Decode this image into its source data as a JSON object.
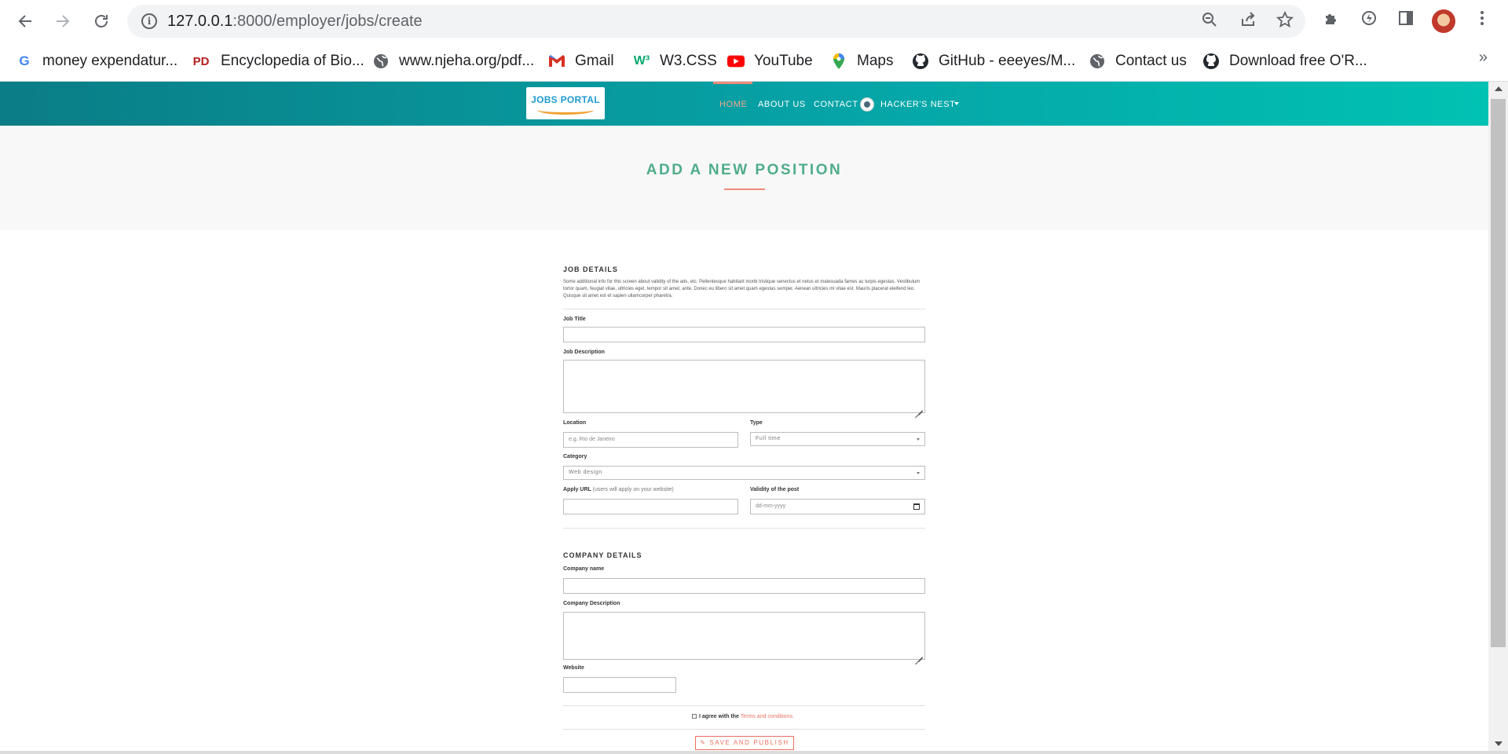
{
  "browser": {
    "url_host": "127.0.0.1",
    "url_path": ":8000/employer/jobs/create",
    "bookmarks": [
      {
        "label": "money expendatur...",
        "icon": "google-icon",
        "color": "#4285f4",
        "glyph": "G"
      },
      {
        "label": "Encyclopedia of Bio...",
        "icon": "pd-icon",
        "color": "#b71c1c",
        "glyph": "PD"
      },
      {
        "label": "www.njeha.org/pdf...",
        "icon": "globe-icon",
        "color": "#5f6368",
        "glyph": "◍"
      },
      {
        "label": "Gmail",
        "icon": "gmail-icon",
        "color": "#d93025",
        "glyph": "M"
      },
      {
        "label": "W3.CSS",
        "icon": "w3-icon",
        "color": "#04aa6d",
        "glyph": "W³"
      },
      {
        "label": "YouTube",
        "icon": "youtube-icon",
        "color": "#ff0000",
        "glyph": "▶"
      },
      {
        "label": "Maps",
        "icon": "maps-icon",
        "color": "#34a853",
        "glyph": "⬤"
      },
      {
        "label": "GitHub - eeeyes/M...",
        "icon": "github-icon",
        "color": "#24292f",
        "glyph": "●"
      },
      {
        "label": "Contact us",
        "icon": "globe-icon",
        "color": "#5f6368",
        "glyph": "◍"
      },
      {
        "label": "Download free O'R...",
        "icon": "github-icon",
        "color": "#24292f",
        "glyph": "●"
      }
    ],
    "more_bookmarks": "»"
  },
  "site": {
    "logo_text": "JOBS PORTAL",
    "nav": {
      "home": "HOME",
      "about": "ABOUT US",
      "contact": "CONTACT",
      "user": "HACKER'S NEST"
    },
    "colors": {
      "header_start": "#0a7d86",
      "header_end": "#00c2b3",
      "accent": "#e8705f",
      "title": "#4fad8a"
    }
  },
  "page": {
    "title": "ADD A NEW POSITION",
    "job_section": {
      "title": "JOB DETAILS",
      "helper": "Some additional info for this screen about validity of the ads, etc. Pellentesque habitant morbi tristique senectus et netus et malesuada fames ac turpis egestas. Vestibulum tortor quam, feugiat vitae, ultricies eget, tempor sit amet, ante. Donec eu libero sit amet quam egestas semper. Aenean ultricies mi vitae est. Mauris placerat eleifend leo. Quisque sit amet est et sapien ullamcorper pharetra.",
      "job_title_label": "Job Title",
      "job_title_value": "",
      "job_description_label": "Job Description",
      "location_label": "Location",
      "location_placeholder": "e.g. Rio de Janeiro",
      "type_label": "Type",
      "type_value": "Full time",
      "category_label": "Category",
      "category_value": "Web design",
      "apply_url_label": "Apply URL",
      "apply_url_hint": "(users will apply on your website)",
      "validity_label": "Validity of the post",
      "validity_placeholder": "dd-mm-yyyy"
    },
    "company_section": {
      "title": "COMPANY DETAILS",
      "company_name_label": "Company name",
      "company_description_label": "Company Description",
      "website_label": "Website"
    },
    "terms_prefix": "I agree with the",
    "terms_link": "Terms and conditions.",
    "publish_button": "SAVE AND PUBLISH",
    "publish_icon": "pencil-icon"
  }
}
